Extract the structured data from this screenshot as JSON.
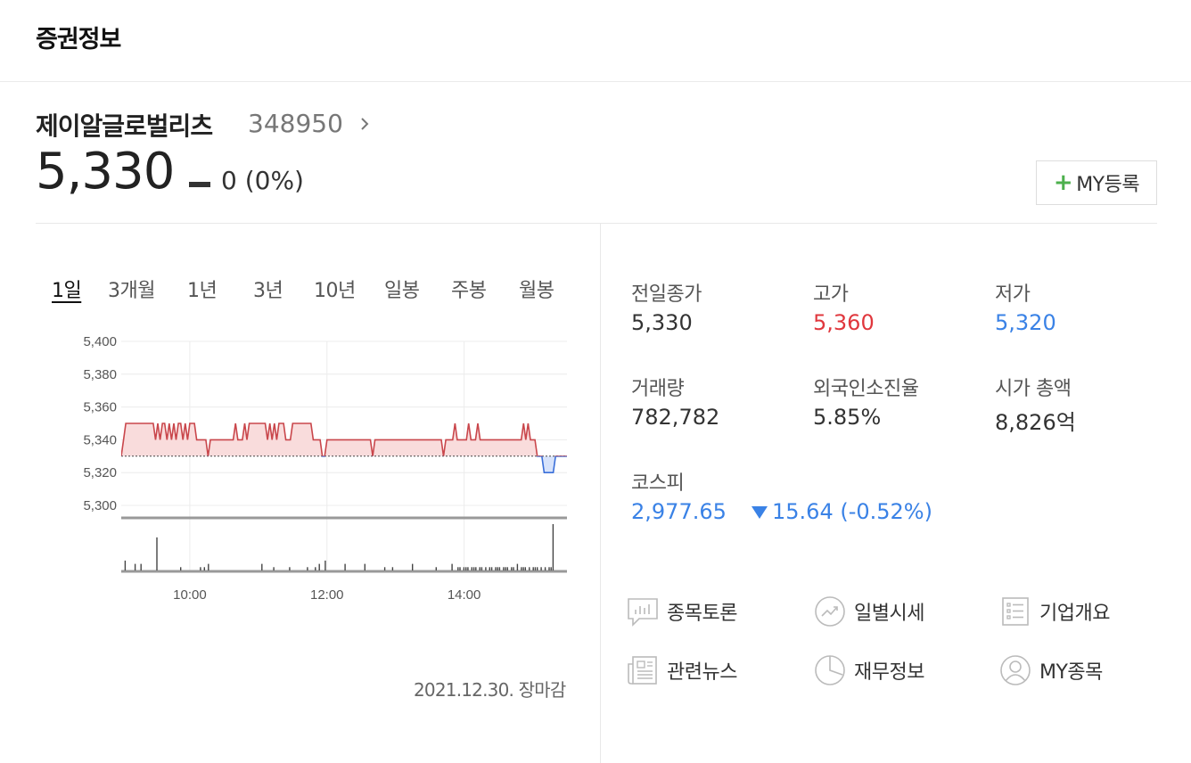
{
  "section": {
    "title": "증권정보"
  },
  "stock": {
    "name": "제이알글로벌리츠",
    "code": "348950",
    "price": "5,330",
    "change": "0 (0%)"
  },
  "my_button": {
    "label": "MY등록",
    "plus": "+"
  },
  "period_tabs": [
    "1일",
    "3개월",
    "1년",
    "3년",
    "10년",
    "일봉",
    "주봉",
    "월봉"
  ],
  "chart_data": {
    "type": "line",
    "y_ticks": [
      "5,400",
      "5,380",
      "5,360",
      "5,340",
      "5,320",
      "5,300"
    ],
    "ylim": [
      5300,
      5400
    ],
    "x_ticks": [
      "10:00",
      "12:00",
      "14:00"
    ],
    "x_range": [
      "9:00",
      "15:30"
    ],
    "reference": 5330,
    "colors": {
      "up": "#c9464b",
      "down": "#3a6fd9",
      "up_fill": "#f9dcdc",
      "down_fill": "#d7e3fb"
    },
    "series": [
      {
        "values": [
          5330,
          5340,
          5350,
          5350,
          5350,
          5350,
          5350,
          5350,
          5350,
          5350,
          5350,
          5350,
          5350,
          5350,
          5350,
          5340,
          5350,
          5340,
          5350,
          5350,
          5340,
          5350,
          5340,
          5350,
          5340,
          5350,
          5350,
          5340,
          5350,
          5340,
          5350,
          5350,
          5350,
          5340,
          5340,
          5340,
          5340,
          5340,
          5330,
          5340,
          5340,
          5340,
          5340,
          5340,
          5340,
          5340,
          5340,
          5340,
          5340,
          5340,
          5350,
          5340,
          5340,
          5340,
          5350,
          5340,
          5350,
          5350,
          5350,
          5350,
          5350,
          5350,
          5350,
          5350,
          5340,
          5350,
          5340,
          5350,
          5340,
          5350,
          5350,
          5350,
          5340,
          5340,
          5340,
          5350,
          5350,
          5350,
          5350,
          5350,
          5350,
          5350,
          5350,
          5350,
          5340,
          5340,
          5340,
          5340,
          5330,
          5330,
          5340,
          5340,
          5340,
          5340,
          5340,
          5340,
          5340,
          5340,
          5340,
          5340,
          5340,
          5340,
          5340,
          5340,
          5340,
          5340,
          5340,
          5340,
          5340,
          5340,
          5330,
          5340,
          5340,
          5340,
          5340,
          5340,
          5340,
          5340,
          5340,
          5340,
          5340,
          5340,
          5340,
          5340,
          5340,
          5340,
          5340,
          5340,
          5340,
          5340,
          5340,
          5340,
          5340,
          5340,
          5340,
          5340,
          5340,
          5340,
          5340,
          5340,
          5340,
          5330,
          5340,
          5340,
          5340,
          5340,
          5350,
          5340,
          5340,
          5340,
          5340,
          5340,
          5350,
          5340,
          5340,
          5340,
          5350,
          5340,
          5340,
          5340,
          5340,
          5340,
          5340,
          5340,
          5340,
          5340,
          5340,
          5340,
          5340,
          5340,
          5340,
          5340,
          5340,
          5340,
          5340,
          5340,
          5350,
          5340,
          5350,
          5340,
          5340,
          5340,
          5330,
          5330,
          5330,
          5320,
          5320,
          5320,
          5320,
          5320,
          5330,
          5330,
          5330,
          5330,
          5330,
          5330
        ]
      }
    ],
    "volume": [
      0,
      0,
      3,
      0,
      0,
      0,
      0,
      2,
      0,
      0,
      2,
      0,
      0,
      0,
      0,
      0,
      0,
      0,
      10,
      0,
      0,
      0,
      0,
      0,
      0,
      0,
      0,
      0,
      0,
      0,
      1,
      0,
      0,
      0,
      0,
      0,
      0,
      0,
      0,
      0,
      1,
      0,
      1,
      0,
      2,
      0,
      0,
      0,
      0,
      0,
      0,
      0,
      0,
      0,
      0,
      0,
      0,
      0,
      0,
      0,
      0,
      0,
      0,
      0,
      0,
      0,
      0,
      0,
      0,
      0,
      0,
      2,
      0,
      0,
      0,
      0,
      0,
      1,
      0,
      0,
      0,
      0,
      0,
      0,
      0,
      1,
      0,
      0,
      0,
      0,
      0,
      0,
      0,
      0,
      1,
      0,
      0,
      0,
      1,
      0,
      2,
      0,
      0,
      3,
      0,
      0,
      0,
      0,
      0,
      0,
      0,
      0,
      0,
      2,
      0,
      0,
      0,
      0,
      0,
      0,
      0,
      0,
      0,
      2,
      0,
      0,
      0,
      0,
      0,
      0,
      0,
      0,
      0,
      1,
      0,
      0,
      0,
      1,
      0,
      0,
      0,
      0,
      0,
      0,
      0,
      0,
      0,
      2,
      0,
      0,
      0,
      0,
      0,
      0,
      0,
      0,
      0,
      0,
      0,
      1,
      0,
      0,
      0,
      0,
      0,
      0,
      0,
      2,
      0,
      0,
      1,
      1,
      0,
      1,
      1,
      1,
      0,
      1,
      1,
      1,
      0,
      1,
      1,
      0,
      1,
      0,
      1,
      1,
      0,
      1,
      1,
      1,
      0,
      1,
      1,
      1,
      0,
      1,
      1,
      0,
      2,
      0,
      1,
      1,
      1,
      0,
      1,
      0,
      1,
      1,
      1,
      0,
      1,
      0,
      1,
      0,
      1,
      1,
      14,
      0,
      0,
      0,
      0,
      0,
      0,
      0
    ]
  },
  "chart_date": "2021.12.30. 장마감",
  "stats": {
    "prev_close": {
      "label": "전일종가",
      "value": "5,330"
    },
    "high": {
      "label": "고가",
      "value": "5,360"
    },
    "low": {
      "label": "저가",
      "value": "5,320"
    },
    "volume": {
      "label": "거래량",
      "value": "782,782"
    },
    "foreign_ratio": {
      "label": "외국인소진율",
      "value": "5.85%"
    },
    "market_cap": {
      "label": "시가 총액",
      "value": "8,826억"
    }
  },
  "kospi": {
    "label": "코스피",
    "value": "2,977.65",
    "change": "15.64 (-0.52%)"
  },
  "links": [
    {
      "label": "종목토론",
      "icon": "discussion-icon"
    },
    {
      "label": "일별시세",
      "icon": "trend-icon"
    },
    {
      "label": "기업개요",
      "icon": "list-icon"
    },
    {
      "label": "관련뉴스",
      "icon": "news-icon"
    },
    {
      "label": "재무정보",
      "icon": "pie-icon"
    },
    {
      "label": "MY종목",
      "icon": "user-icon"
    }
  ]
}
